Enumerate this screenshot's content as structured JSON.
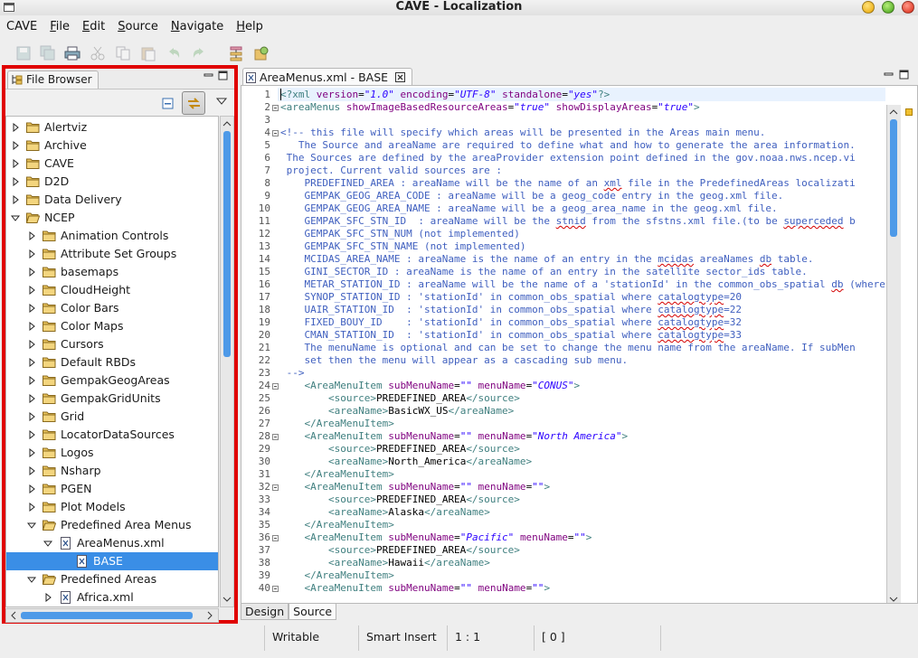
{
  "window": {
    "title": "CAVE - Localization"
  },
  "menubar": {
    "items": [
      {
        "label": "CAVE",
        "mnemonic": "",
        "rest": "CAVE"
      },
      {
        "label": "File",
        "mnemonic": "F",
        "rest": "ile"
      },
      {
        "label": "Edit",
        "mnemonic": "E",
        "rest": "dit"
      },
      {
        "label": "Source",
        "mnemonic": "S",
        "rest": "ource"
      },
      {
        "label": "Navigate",
        "mnemonic": "N",
        "rest": "avigate"
      },
      {
        "label": "Help",
        "mnemonic": "H",
        "rest": "elp"
      }
    ]
  },
  "toolbar": {
    "icons": [
      "save-icon",
      "save-all-icon",
      "print-icon",
      "cut-icon",
      "copy-icon",
      "paste-icon",
      "undo-icon",
      "redo-icon",
      "hierarchy-icon",
      "open-type-icon"
    ]
  },
  "file_browser": {
    "tab_label": "File Browser",
    "tree": [
      {
        "label": "Alertviz",
        "depth": 0,
        "expanded": false,
        "kind": "folder"
      },
      {
        "label": "Archive",
        "depth": 0,
        "expanded": false,
        "kind": "folder"
      },
      {
        "label": "CAVE",
        "depth": 0,
        "expanded": false,
        "kind": "folder"
      },
      {
        "label": "D2D",
        "depth": 0,
        "expanded": false,
        "kind": "folder"
      },
      {
        "label": "Data Delivery",
        "depth": 0,
        "expanded": false,
        "kind": "folder"
      },
      {
        "label": "NCEP",
        "depth": 0,
        "expanded": true,
        "kind": "folder"
      },
      {
        "label": "Animation Controls",
        "depth": 1,
        "expanded": false,
        "kind": "folder"
      },
      {
        "label": "Attribute Set Groups",
        "depth": 1,
        "expanded": false,
        "kind": "folder"
      },
      {
        "label": "basemaps",
        "depth": 1,
        "expanded": false,
        "kind": "folder"
      },
      {
        "label": "CloudHeight",
        "depth": 1,
        "expanded": false,
        "kind": "folder"
      },
      {
        "label": "Color Bars",
        "depth": 1,
        "expanded": false,
        "kind": "folder"
      },
      {
        "label": "Color Maps",
        "depth": 1,
        "expanded": false,
        "kind": "folder"
      },
      {
        "label": "Cursors",
        "depth": 1,
        "expanded": false,
        "kind": "folder"
      },
      {
        "label": "Default RBDs",
        "depth": 1,
        "expanded": false,
        "kind": "folder"
      },
      {
        "label": "GempakGeogAreas",
        "depth": 1,
        "expanded": false,
        "kind": "folder"
      },
      {
        "label": "GempakGridUnits",
        "depth": 1,
        "expanded": false,
        "kind": "folder"
      },
      {
        "label": "Grid",
        "depth": 1,
        "expanded": false,
        "kind": "folder"
      },
      {
        "label": "LocatorDataSources",
        "depth": 1,
        "expanded": false,
        "kind": "folder"
      },
      {
        "label": "Logos",
        "depth": 1,
        "expanded": false,
        "kind": "folder"
      },
      {
        "label": "Nsharp",
        "depth": 1,
        "expanded": false,
        "kind": "folder"
      },
      {
        "label": "PGEN",
        "depth": 1,
        "expanded": false,
        "kind": "folder"
      },
      {
        "label": "Plot Models",
        "depth": 1,
        "expanded": false,
        "kind": "folder"
      },
      {
        "label": "Predefined Area Menus",
        "depth": 1,
        "expanded": true,
        "kind": "folder"
      },
      {
        "label": "AreaMenus.xml",
        "depth": 2,
        "expanded": true,
        "kind": "xml"
      },
      {
        "label": "BASE",
        "depth": 3,
        "expanded": null,
        "kind": "xml",
        "selected": true
      },
      {
        "label": "Predefined Areas",
        "depth": 1,
        "expanded": true,
        "kind": "folder"
      },
      {
        "label": "Africa.xml",
        "depth": 2,
        "expanded": false,
        "kind": "xml"
      }
    ]
  },
  "editor": {
    "tab_label": "AreaMenus.xml - BASE",
    "bottom_tabs": [
      "Design",
      "Source"
    ],
    "active_bottom_tab": "Source",
    "folded_lines": [
      2,
      4,
      24,
      28,
      32,
      36,
      40
    ],
    "lines": [
      [
        [
          "pi",
          "<?xml "
        ],
        [
          "attr",
          "version"
        ],
        [
          "txt",
          "="
        ],
        [
          "val",
          "\"1.0\""
        ],
        [
          "txt",
          " "
        ],
        [
          "attr",
          "encoding"
        ],
        [
          "txt",
          "="
        ],
        [
          "val",
          "\"UTF-8\""
        ],
        [
          "txt",
          " "
        ],
        [
          "attr",
          "standalone"
        ],
        [
          "txt",
          "="
        ],
        [
          "val",
          "\"yes\""
        ],
        [
          "pi",
          "?>"
        ]
      ],
      [
        [
          "tag",
          "<areaMenus "
        ],
        [
          "attr",
          "showImageBasedResourceAreas"
        ],
        [
          "txt",
          "="
        ],
        [
          "val",
          "\"true\""
        ],
        [
          "txt",
          " "
        ],
        [
          "attr",
          "showDisplayAreas"
        ],
        [
          "txt",
          "="
        ],
        [
          "val",
          "\"true\""
        ],
        [
          "tag",
          ">"
        ]
      ],
      [],
      [
        [
          "com",
          "<!-- this file will specify which areas will be presented in the Areas main menu."
        ]
      ],
      [
        [
          "com",
          "   The Source and areaName are required to define what and how to generate the area information."
        ]
      ],
      [
        [
          "com",
          " The Sources are defined by the areaProvider extension point defined in the gov.noaa.nws.ncep.vi"
        ]
      ],
      [
        [
          "com",
          " project. Current valid sources are :"
        ]
      ],
      [
        [
          "com",
          "    PREDEFINED_AREA : areaName will be the name of an "
        ],
        [
          "comsq",
          "xml"
        ],
        [
          "com",
          " file in the PredefinedAreas localizati"
        ]
      ],
      [
        [
          "com",
          "    GEMPAK_GEOG_AREA_CODE : areaName will be a geog_code entry in the geog.xml file."
        ]
      ],
      [
        [
          "com",
          "    GEMPAK_GEOG_AREA_NAME : areaName will be a geog_area_name in the geog.xml file."
        ]
      ],
      [
        [
          "com",
          "    GEMPAK_SFC_STN_ID  : areaName will be the "
        ],
        [
          "comsq",
          "stnid"
        ],
        [
          "com",
          " from the sfstns.xml file.(to be "
        ],
        [
          "comsq",
          "superceded"
        ],
        [
          "com",
          " b"
        ]
      ],
      [
        [
          "com",
          "    GEMPAK_SFC_STN_NUM (not implemented)"
        ]
      ],
      [
        [
          "com",
          "    GEMPAK_SFC_STN_NAME (not implemented)"
        ]
      ],
      [
        [
          "com",
          "    MCIDAS_AREA_NAME : areaName is the name of an entry in the "
        ],
        [
          "comsq",
          "mcidas"
        ],
        [
          "com",
          " areaNames "
        ],
        [
          "comsq",
          "db"
        ],
        [
          "com",
          " table."
        ]
      ],
      [
        [
          "com",
          "    GINI_SECTOR_ID : areaName is the name of an entry in the satellite sector_ids table."
        ]
      ],
      [
        [
          "com",
          "    METAR_STATION_ID : areaName will be the name of a 'stationId' in the common_obs_spatial "
        ],
        [
          "comsq",
          "db"
        ],
        [
          "com",
          " (where"
        ]
      ],
      [
        [
          "com",
          "    SYNOP_STATION_ID : 'stationId' in common_obs_spatial where "
        ],
        [
          "comsq",
          "catalogtype"
        ],
        [
          "com",
          "=20"
        ]
      ],
      [
        [
          "com",
          "    UAIR_STATION_ID  : 'stationId' in common_obs_spatial where "
        ],
        [
          "comsq",
          "catalogtype"
        ],
        [
          "com",
          "=22"
        ]
      ],
      [
        [
          "com",
          "    FIXED_BOUY_ID    : 'stationId' in common_obs_spatial where "
        ],
        [
          "comsq",
          "catalogtype"
        ],
        [
          "com",
          "=32"
        ]
      ],
      [
        [
          "com",
          "    CMAN_STATION_ID  : 'stationId' in common_obs_spatial where "
        ],
        [
          "comsq",
          "catalogtype"
        ],
        [
          "com",
          "=33"
        ]
      ],
      [
        [
          "com",
          "    The menuName is optional and can be set to change the menu name from the areaName. If subMen"
        ]
      ],
      [
        [
          "com",
          "    set then the menu will appear as a cascading sub menu."
        ]
      ],
      [
        [
          "com",
          " -->"
        ]
      ],
      [
        [
          "txt",
          "    "
        ],
        [
          "tag",
          "<AreaMenuItem "
        ],
        [
          "attr",
          "subMenuName"
        ],
        [
          "txt",
          "="
        ],
        [
          "val",
          "\"\""
        ],
        [
          "txt",
          " "
        ],
        [
          "attr",
          "menuName"
        ],
        [
          "txt",
          "="
        ],
        [
          "val",
          "\"CONUS\""
        ],
        [
          "tag",
          ">"
        ]
      ],
      [
        [
          "txt",
          "        "
        ],
        [
          "tag",
          "<source>"
        ],
        [
          "txt",
          "PREDEFINED_AREA"
        ],
        [
          "tag",
          "</source>"
        ]
      ],
      [
        [
          "txt",
          "        "
        ],
        [
          "tag",
          "<areaName>"
        ],
        [
          "txt",
          "BasicWX_US"
        ],
        [
          "tag",
          "</areaName>"
        ]
      ],
      [
        [
          "txt",
          "    "
        ],
        [
          "tag",
          "</AreaMenuItem>"
        ]
      ],
      [
        [
          "txt",
          "    "
        ],
        [
          "tag",
          "<AreaMenuItem "
        ],
        [
          "attr",
          "subMenuName"
        ],
        [
          "txt",
          "="
        ],
        [
          "val",
          "\"\""
        ],
        [
          "txt",
          " "
        ],
        [
          "attr",
          "menuName"
        ],
        [
          "txt",
          "="
        ],
        [
          "val",
          "\"North America\""
        ],
        [
          "tag",
          ">"
        ]
      ],
      [
        [
          "txt",
          "        "
        ],
        [
          "tag",
          "<source>"
        ],
        [
          "txt",
          "PREDEFINED_AREA"
        ],
        [
          "tag",
          "</source>"
        ]
      ],
      [
        [
          "txt",
          "        "
        ],
        [
          "tag",
          "<areaName>"
        ],
        [
          "txt",
          "North_America"
        ],
        [
          "tag",
          "</areaName>"
        ]
      ],
      [
        [
          "txt",
          "    "
        ],
        [
          "tag",
          "</AreaMenuItem>"
        ]
      ],
      [
        [
          "txt",
          "    "
        ],
        [
          "tag",
          "<AreaMenuItem "
        ],
        [
          "attr",
          "subMenuName"
        ],
        [
          "txt",
          "="
        ],
        [
          "val",
          "\"\""
        ],
        [
          "txt",
          " "
        ],
        [
          "attr",
          "menuName"
        ],
        [
          "txt",
          "="
        ],
        [
          "val",
          "\"\""
        ],
        [
          "tag",
          ">"
        ]
      ],
      [
        [
          "txt",
          "        "
        ],
        [
          "tag",
          "<source>"
        ],
        [
          "txt",
          "PREDEFINED_AREA"
        ],
        [
          "tag",
          "</source>"
        ]
      ],
      [
        [
          "txt",
          "        "
        ],
        [
          "tag",
          "<areaName>"
        ],
        [
          "txt",
          "Alaska"
        ],
        [
          "tag",
          "</areaName>"
        ]
      ],
      [
        [
          "txt",
          "    "
        ],
        [
          "tag",
          "</AreaMenuItem>"
        ]
      ],
      [
        [
          "txt",
          "    "
        ],
        [
          "tag",
          "<AreaMenuItem "
        ],
        [
          "attr",
          "subMenuName"
        ],
        [
          "txt",
          "="
        ],
        [
          "val",
          "\"Pacific\""
        ],
        [
          "txt",
          " "
        ],
        [
          "attr",
          "menuName"
        ],
        [
          "txt",
          "="
        ],
        [
          "val",
          "\"\""
        ],
        [
          "tag",
          ">"
        ]
      ],
      [
        [
          "txt",
          "        "
        ],
        [
          "tag",
          "<source>"
        ],
        [
          "txt",
          "PREDEFINED_AREA"
        ],
        [
          "tag",
          "</source>"
        ]
      ],
      [
        [
          "txt",
          "        "
        ],
        [
          "tag",
          "<areaName>"
        ],
        [
          "txt",
          "Hawaii"
        ],
        [
          "tag",
          "</areaName>"
        ]
      ],
      [
        [
          "txt",
          "    "
        ],
        [
          "tag",
          "</AreaMenuItem>"
        ]
      ],
      [
        [
          "txt",
          "    "
        ],
        [
          "tag",
          "<AreaMenuItem "
        ],
        [
          "attr",
          "subMenuName"
        ],
        [
          "txt",
          "="
        ],
        [
          "val",
          "\"\""
        ],
        [
          "txt",
          " "
        ],
        [
          "attr",
          "menuName"
        ],
        [
          "txt",
          "="
        ],
        [
          "val",
          "\"\""
        ],
        [
          "tag",
          ">"
        ]
      ]
    ]
  },
  "statusbar": {
    "mode": "Writable",
    "insert_mode": "Smart Insert",
    "position": "1 : 1",
    "count": "[ 0 ]"
  },
  "colors": {
    "highlight": "#e00000",
    "selection": "#3a8ee6",
    "scroll_thumb": "#4e9ae8",
    "folder": "#e8c25a"
  }
}
